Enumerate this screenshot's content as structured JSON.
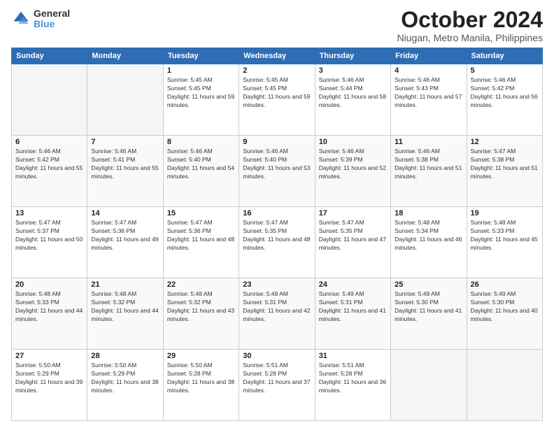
{
  "logo": {
    "general": "General",
    "blue": "Blue"
  },
  "header": {
    "month": "October 2024",
    "location": "Niugan, Metro Manila, Philippines"
  },
  "weekdays": [
    "Sunday",
    "Monday",
    "Tuesday",
    "Wednesday",
    "Thursday",
    "Friday",
    "Saturday"
  ],
  "weeks": [
    [
      {
        "day": "",
        "sunrise": "",
        "sunset": "",
        "daylight": ""
      },
      {
        "day": "",
        "sunrise": "",
        "sunset": "",
        "daylight": ""
      },
      {
        "day": "1",
        "sunrise": "Sunrise: 5:45 AM",
        "sunset": "Sunset: 5:45 PM",
        "daylight": "Daylight: 11 hours and 59 minutes."
      },
      {
        "day": "2",
        "sunrise": "Sunrise: 5:45 AM",
        "sunset": "Sunset: 5:45 PM",
        "daylight": "Daylight: 11 hours and 59 minutes."
      },
      {
        "day": "3",
        "sunrise": "Sunrise: 5:46 AM",
        "sunset": "Sunset: 5:44 PM",
        "daylight": "Daylight: 11 hours and 58 minutes."
      },
      {
        "day": "4",
        "sunrise": "Sunrise: 5:46 AM",
        "sunset": "Sunset: 5:43 PM",
        "daylight": "Daylight: 11 hours and 57 minutes."
      },
      {
        "day": "5",
        "sunrise": "Sunrise: 5:46 AM",
        "sunset": "Sunset: 5:42 PM",
        "daylight": "Daylight: 11 hours and 56 minutes."
      }
    ],
    [
      {
        "day": "6",
        "sunrise": "Sunrise: 5:46 AM",
        "sunset": "Sunset: 5:42 PM",
        "daylight": "Daylight: 11 hours and 55 minutes."
      },
      {
        "day": "7",
        "sunrise": "Sunrise: 5:46 AM",
        "sunset": "Sunset: 5:41 PM",
        "daylight": "Daylight: 11 hours and 55 minutes."
      },
      {
        "day": "8",
        "sunrise": "Sunrise: 5:46 AM",
        "sunset": "Sunset: 5:40 PM",
        "daylight": "Daylight: 11 hours and 54 minutes."
      },
      {
        "day": "9",
        "sunrise": "Sunrise: 5:46 AM",
        "sunset": "Sunset: 5:40 PM",
        "daylight": "Daylight: 11 hours and 53 minutes."
      },
      {
        "day": "10",
        "sunrise": "Sunrise: 5:46 AM",
        "sunset": "Sunset: 5:39 PM",
        "daylight": "Daylight: 11 hours and 52 minutes."
      },
      {
        "day": "11",
        "sunrise": "Sunrise: 5:46 AM",
        "sunset": "Sunset: 5:38 PM",
        "daylight": "Daylight: 11 hours and 51 minutes."
      },
      {
        "day": "12",
        "sunrise": "Sunrise: 5:47 AM",
        "sunset": "Sunset: 5:38 PM",
        "daylight": "Daylight: 11 hours and 51 minutes."
      }
    ],
    [
      {
        "day": "13",
        "sunrise": "Sunrise: 5:47 AM",
        "sunset": "Sunset: 5:37 PM",
        "daylight": "Daylight: 11 hours and 50 minutes."
      },
      {
        "day": "14",
        "sunrise": "Sunrise: 5:47 AM",
        "sunset": "Sunset: 5:36 PM",
        "daylight": "Daylight: 11 hours and 49 minutes."
      },
      {
        "day": "15",
        "sunrise": "Sunrise: 5:47 AM",
        "sunset": "Sunset: 5:36 PM",
        "daylight": "Daylight: 11 hours and 48 minutes."
      },
      {
        "day": "16",
        "sunrise": "Sunrise: 5:47 AM",
        "sunset": "Sunset: 5:35 PM",
        "daylight": "Daylight: 11 hours and 48 minutes."
      },
      {
        "day": "17",
        "sunrise": "Sunrise: 5:47 AM",
        "sunset": "Sunset: 5:35 PM",
        "daylight": "Daylight: 11 hours and 47 minutes."
      },
      {
        "day": "18",
        "sunrise": "Sunrise: 5:48 AM",
        "sunset": "Sunset: 5:34 PM",
        "daylight": "Daylight: 11 hours and 46 minutes."
      },
      {
        "day": "19",
        "sunrise": "Sunrise: 5:48 AM",
        "sunset": "Sunset: 5:33 PM",
        "daylight": "Daylight: 11 hours and 45 minutes."
      }
    ],
    [
      {
        "day": "20",
        "sunrise": "Sunrise: 5:48 AM",
        "sunset": "Sunset: 5:33 PM",
        "daylight": "Daylight: 11 hours and 44 minutes."
      },
      {
        "day": "21",
        "sunrise": "Sunrise: 5:48 AM",
        "sunset": "Sunset: 5:32 PM",
        "daylight": "Daylight: 11 hours and 44 minutes."
      },
      {
        "day": "22",
        "sunrise": "Sunrise: 5:48 AM",
        "sunset": "Sunset: 5:32 PM",
        "daylight": "Daylight: 11 hours and 43 minutes."
      },
      {
        "day": "23",
        "sunrise": "Sunrise: 5:49 AM",
        "sunset": "Sunset: 5:31 PM",
        "daylight": "Daylight: 11 hours and 42 minutes."
      },
      {
        "day": "24",
        "sunrise": "Sunrise: 5:49 AM",
        "sunset": "Sunset: 5:31 PM",
        "daylight": "Daylight: 11 hours and 41 minutes."
      },
      {
        "day": "25",
        "sunrise": "Sunrise: 5:49 AM",
        "sunset": "Sunset: 5:30 PM",
        "daylight": "Daylight: 11 hours and 41 minutes."
      },
      {
        "day": "26",
        "sunrise": "Sunrise: 5:49 AM",
        "sunset": "Sunset: 5:30 PM",
        "daylight": "Daylight: 11 hours and 40 minutes."
      }
    ],
    [
      {
        "day": "27",
        "sunrise": "Sunrise: 5:50 AM",
        "sunset": "Sunset: 5:29 PM",
        "daylight": "Daylight: 11 hours and 39 minutes."
      },
      {
        "day": "28",
        "sunrise": "Sunrise: 5:50 AM",
        "sunset": "Sunset: 5:29 PM",
        "daylight": "Daylight: 11 hours and 38 minutes."
      },
      {
        "day": "29",
        "sunrise": "Sunrise: 5:50 AM",
        "sunset": "Sunset: 5:28 PM",
        "daylight": "Daylight: 11 hours and 38 minutes."
      },
      {
        "day": "30",
        "sunrise": "Sunrise: 5:51 AM",
        "sunset": "Sunset: 5:28 PM",
        "daylight": "Daylight: 11 hours and 37 minutes."
      },
      {
        "day": "31",
        "sunrise": "Sunrise: 5:51 AM",
        "sunset": "Sunset: 5:28 PM",
        "daylight": "Daylight: 11 hours and 36 minutes."
      },
      {
        "day": "",
        "sunrise": "",
        "sunset": "",
        "daylight": ""
      },
      {
        "day": "",
        "sunrise": "",
        "sunset": "",
        "daylight": ""
      }
    ]
  ]
}
